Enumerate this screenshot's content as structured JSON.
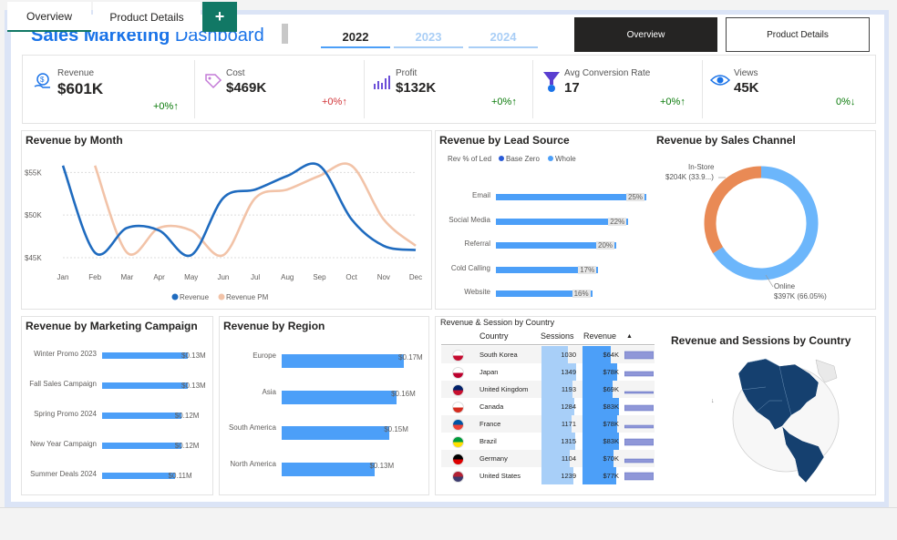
{
  "header": {
    "title_bold": "Sales Marketing",
    "title_rest": "Dashboard",
    "years": [
      "2022",
      "2023",
      "2024"
    ],
    "nav_overview": "Overview",
    "nav_product": "Product Details"
  },
  "kpis": [
    {
      "label": "Revenue",
      "value": "$601K",
      "change": "+0%↑"
    },
    {
      "label": "Cost",
      "value": "$469K",
      "change": "+0%↑"
    },
    {
      "label": "Profit",
      "value": "$132K",
      "change": "+0%↑"
    },
    {
      "label": "Avg Conversion Rate",
      "value": "17",
      "change": "+0%↑"
    },
    {
      "label": "Views",
      "value": "45K",
      "change": "0%↓"
    }
  ],
  "colors": {
    "accent": "#1a73e8",
    "bar": "#4c9ff8",
    "revenue": "#1f6bbf",
    "revenue_pm": "#f2c3a8",
    "donut_online": "#6cb6fb",
    "donut_instore": "#e98a55",
    "positive": "#0a7a0a",
    "negative": "#d13438"
  },
  "revenue_by_month": {
    "title": "Revenue by Month",
    "chart_data": {
      "type": "line",
      "categories": [
        "Jan",
        "Feb",
        "Mar",
        "Apr",
        "May",
        "Jun",
        "Jul",
        "Aug",
        "Sep",
        "Oct",
        "Nov",
        "Dec"
      ],
      "ylim": [
        45000,
        56000
      ],
      "yticks": [
        "$45K",
        "$50K",
        "$55K"
      ],
      "series": [
        {
          "name": "Revenue",
          "values": [
            55800,
            45600,
            48500,
            48200,
            45300,
            52000,
            53000,
            54600,
            55800,
            49500,
            46400,
            45900
          ]
        },
        {
          "name": "Revenue PM",
          "values": [
            null,
            55800,
            45600,
            48500,
            48200,
            45300,
            52000,
            53000,
            54600,
            55800,
            49500,
            46400
          ]
        }
      ]
    }
  },
  "lead_source": {
    "title": "Revenue by Lead Source",
    "legend_label": "Rev % of Led",
    "legend_items": [
      "Base Zero",
      "Whole"
    ],
    "chart_data": {
      "type": "bar",
      "categories": [
        "Email",
        "Social Media",
        "Referral",
        "Cold Calling",
        "Website"
      ],
      "values": [
        25,
        22,
        20,
        17,
        16
      ],
      "labels": [
        "25%",
        "22%",
        "20%",
        "17%",
        "16%"
      ]
    }
  },
  "sales_channel": {
    "title": "Revenue by Sales Channel",
    "chart_data": {
      "type": "pie",
      "categories": [
        "In-Store",
        "Online"
      ],
      "values": [
        33.9,
        66.05
      ]
    },
    "label_instore_1": "In-Store",
    "label_instore_2": "$204K (33.9...)",
    "label_online_1": "Online",
    "label_online_2": "$397K (66.05%)"
  },
  "campaign": {
    "title": "Revenue by Marketing Campaign",
    "chart_data": {
      "type": "bar",
      "categories": [
        "Winter Promo 2023",
        "Fall Sales Campaign",
        "Spring Promo 2024",
        "New Year Campaign",
        "Summer Deals 2024"
      ],
      "values": [
        0.13,
        0.13,
        0.12,
        0.12,
        0.11
      ],
      "labels": [
        "$0.13M",
        "$0.13M",
        "$0.12M",
        "$0.12M",
        "$0.11M"
      ]
    }
  },
  "region": {
    "title": "Revenue by Region",
    "chart_data": {
      "type": "bar",
      "categories": [
        "Europe",
        "Asia",
        "South America",
        "North America"
      ],
      "values": [
        0.17,
        0.16,
        0.15,
        0.13
      ],
      "labels": [
        "$0.17M",
        "$0.16M",
        "$0.15M",
        "$0.13M"
      ]
    }
  },
  "country_table": {
    "title": "Revenue & Session by Country",
    "headers": [
      "Country",
      "Sessions",
      "Revenue"
    ],
    "rows": [
      {
        "flag": "south-korea-flag",
        "country": "South Korea",
        "sessions": "1030",
        "revenue": "$64K"
      },
      {
        "flag": "japan-flag",
        "country": "Japan",
        "sessions": "1349",
        "revenue": "$78K"
      },
      {
        "flag": "uk-flag",
        "country": "United Kingdom",
        "sessions": "1193",
        "revenue": "$69K"
      },
      {
        "flag": "canada-flag",
        "country": "Canada",
        "sessions": "1284",
        "revenue": "$83K"
      },
      {
        "flag": "france-flag",
        "country": "France",
        "sessions": "1171",
        "revenue": "$78K"
      },
      {
        "flag": "brazil-flag",
        "country": "Brazil",
        "sessions": "1315",
        "revenue": "$83K"
      },
      {
        "flag": "germany-flag",
        "country": "Germany",
        "sessions": "1104",
        "revenue": "$70K"
      },
      {
        "flag": "usa-flag",
        "country": "United States",
        "sessions": "1239",
        "revenue": "$77K"
      }
    ]
  },
  "map": {
    "title": "Revenue and Sessions by Country"
  },
  "tabs": {
    "overview": "Overview",
    "product": "Product Details",
    "add": "+"
  }
}
